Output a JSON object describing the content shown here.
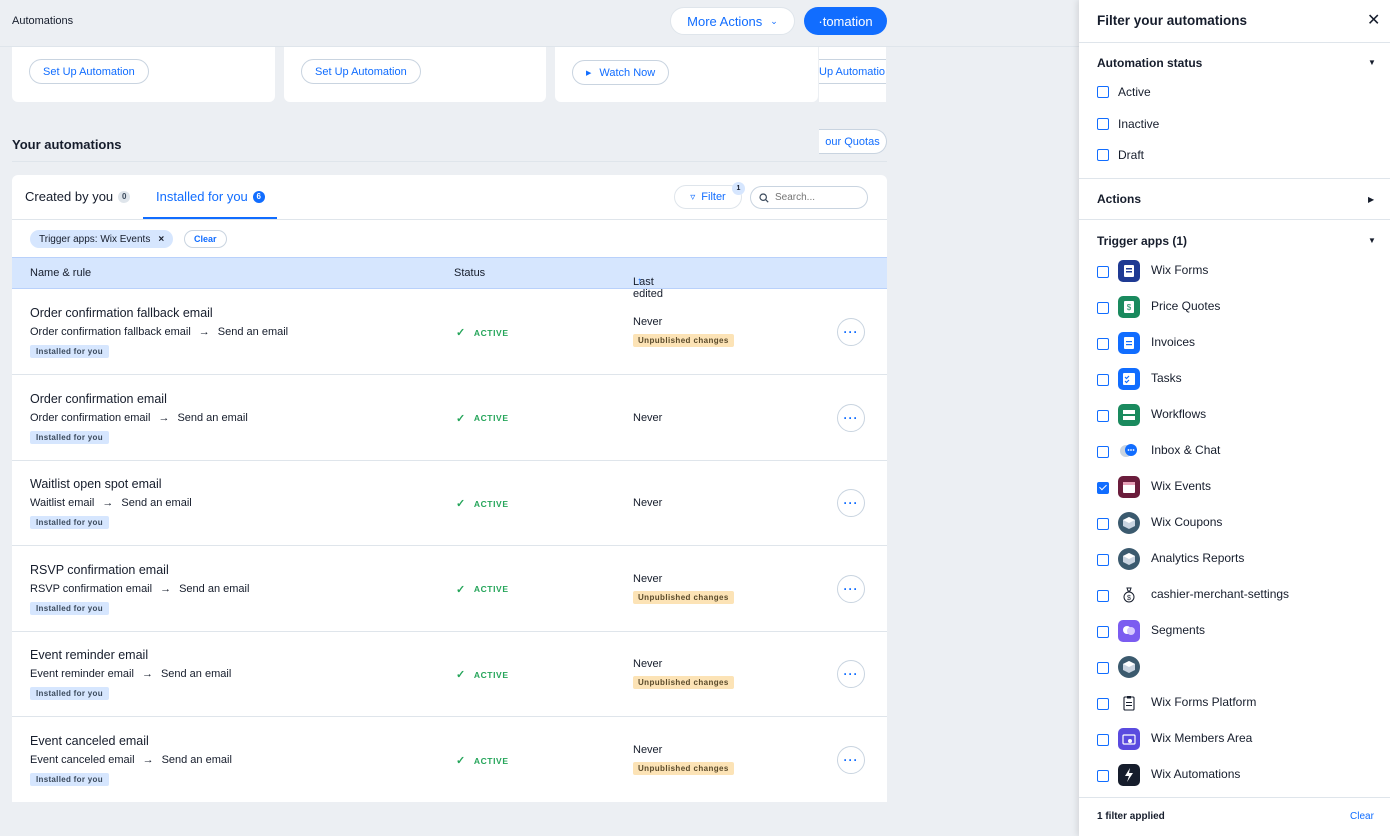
{
  "header": {
    "title": "Automations",
    "more_actions": "More Actions",
    "primary_label": "·tomation"
  },
  "cards": [
    {
      "button": "Set Up Automation"
    },
    {
      "button": "Set Up Automation"
    },
    {
      "button": "Watch Now"
    },
    {
      "button": "Up Automatio"
    }
  ],
  "section": {
    "title": "Your automations",
    "quotas": "our Quotas"
  },
  "tabs": [
    {
      "label": "Created by you",
      "count": "0"
    },
    {
      "label": "Installed for you",
      "count": "6"
    }
  ],
  "filter": {
    "label": "Filter",
    "badge": "1",
    "search_placeholder": "Search..."
  },
  "chips": {
    "trigger": "Trigger apps: Wix Events",
    "clear": "Clear"
  },
  "table": {
    "columns": [
      "Name & rule",
      "Status",
      "Last edited"
    ],
    "rows": [
      {
        "name": "Order confirmation fallback email",
        "trigger": "Order confirmation fallback email",
        "action": "Send an email",
        "tag": "Installed for you",
        "status": "ACTIVE",
        "edited": "Never",
        "unpublished": "Unpublished changes"
      },
      {
        "name": "Order confirmation email",
        "trigger": "Order confirmation email",
        "action": "Send an email",
        "tag": "Installed for you",
        "status": "ACTIVE",
        "edited": "Never",
        "unpublished": ""
      },
      {
        "name": "Waitlist open spot email",
        "trigger": "Waitlist email",
        "action": "Send an email",
        "tag": "Installed for you",
        "status": "ACTIVE",
        "edited": "Never",
        "unpublished": ""
      },
      {
        "name": "RSVP confirmation email",
        "trigger": "RSVP confirmation email",
        "action": "Send an email",
        "tag": "Installed for you",
        "status": "ACTIVE",
        "edited": "Never",
        "unpublished": "Unpublished changes"
      },
      {
        "name": "Event reminder email",
        "trigger": "Event reminder email",
        "action": "Send an email",
        "tag": "Installed for you",
        "status": "ACTIVE",
        "edited": "Never",
        "unpublished": "Unpublished changes"
      },
      {
        "name": "Event canceled email",
        "trigger": "Event canceled email",
        "action": "Send an email",
        "tag": "Installed for you",
        "status": "ACTIVE",
        "edited": "Never",
        "unpublished": "Unpublished changes"
      }
    ]
  },
  "sidebar": {
    "title": "Filter your automations",
    "status_section": "Automation status",
    "statuses": [
      {
        "label": "Active",
        "checked": false
      },
      {
        "label": "Inactive",
        "checked": false
      },
      {
        "label": "Draft",
        "checked": false
      }
    ],
    "actions_section": "Actions",
    "trigger_section": "Trigger apps (1)",
    "apps": [
      {
        "label": "Wix Forms",
        "icon": "forms-icon",
        "color": "#1f3a93",
        "checked": false
      },
      {
        "label": "Price Quotes",
        "icon": "quotes-icon",
        "color": "#1a8a5e",
        "checked": false
      },
      {
        "label": "Invoices",
        "icon": "invoice-icon",
        "color": "#116dff",
        "checked": false
      },
      {
        "label": "Tasks",
        "icon": "tasks-icon",
        "color": "#116dff",
        "checked": false
      },
      {
        "label": "Workflows",
        "icon": "workflows-icon",
        "color": "#1a8a5e",
        "checked": false
      },
      {
        "label": "Inbox & Chat",
        "icon": "chat-icon",
        "color": "#116dff",
        "checked": false
      },
      {
        "label": "Wix Events",
        "icon": "events-icon",
        "color": "#6b1d3c",
        "checked": true
      },
      {
        "label": "Wix Coupons",
        "icon": "cube-icon",
        "color": "#3b5a6e",
        "checked": false
      },
      {
        "label": "Analytics Reports",
        "icon": "cube-icon",
        "color": "#3b5a6e",
        "checked": false
      },
      {
        "label": "cashier-merchant-settings",
        "icon": "money-bag-icon",
        "color": "#ffffff",
        "checked": false
      },
      {
        "label": "Segments",
        "icon": "segments-icon",
        "color": "#7b5cf0",
        "checked": false
      },
      {
        "label": "",
        "icon": "cube-icon",
        "color": "#3b5a6e",
        "checked": false
      },
      {
        "label": "Wix Forms Platform",
        "icon": "clipboard-icon",
        "color": "#ffffff",
        "checked": false
      },
      {
        "label": "Wix Members Area",
        "icon": "members-icon",
        "color": "#5a4bdf",
        "checked": false
      },
      {
        "label": "Wix Automations",
        "icon": "bolt-icon",
        "color": "#161d2c",
        "checked": false
      }
    ],
    "footer_text": "1 filter applied",
    "footer_clear": "Clear"
  }
}
